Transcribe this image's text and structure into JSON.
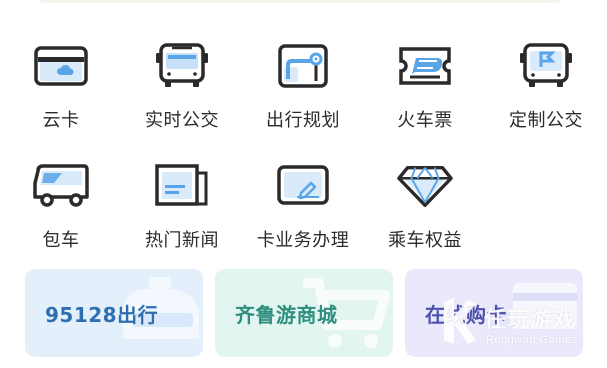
{
  "menu": {
    "row1": [
      {
        "label": "云卡",
        "icon": "cloud-card-icon"
      },
      {
        "label": "实时公交",
        "icon": "bus-icon"
      },
      {
        "label": "出行规划",
        "icon": "route-map-icon"
      },
      {
        "label": "火车票",
        "icon": "train-ticket-icon"
      },
      {
        "label": "定制公交",
        "icon": "custom-bus-icon"
      }
    ],
    "row2": [
      {
        "label": "包车",
        "icon": "van-icon"
      },
      {
        "label": "热门新闻",
        "icon": "newspaper-icon"
      },
      {
        "label": "卡业务办理",
        "icon": "card-service-icon"
      },
      {
        "label": "乘车权益",
        "icon": "diamond-icon"
      }
    ]
  },
  "cards": [
    {
      "label": "95128出行",
      "color": "#2f6fb0",
      "bg": "#e3effb",
      "icon": "taxi-icon"
    },
    {
      "label": "齐鲁游商城",
      "color": "#2f8f7e",
      "bg": "#e2f5f1",
      "icon": "cart-icon"
    },
    {
      "label": "在线购卡",
      "color": "#4e52ad",
      "bg": "#e9e9fb",
      "icon": "card-icon"
    }
  ],
  "colors": {
    "icon_stroke": "#2a2a2a",
    "icon_fill": "#5aa4e8",
    "icon_fill_light": "#cfe6fb"
  },
  "watermark": {
    "title": "任玩游戏",
    "subtitle": "Rengwan Games"
  }
}
